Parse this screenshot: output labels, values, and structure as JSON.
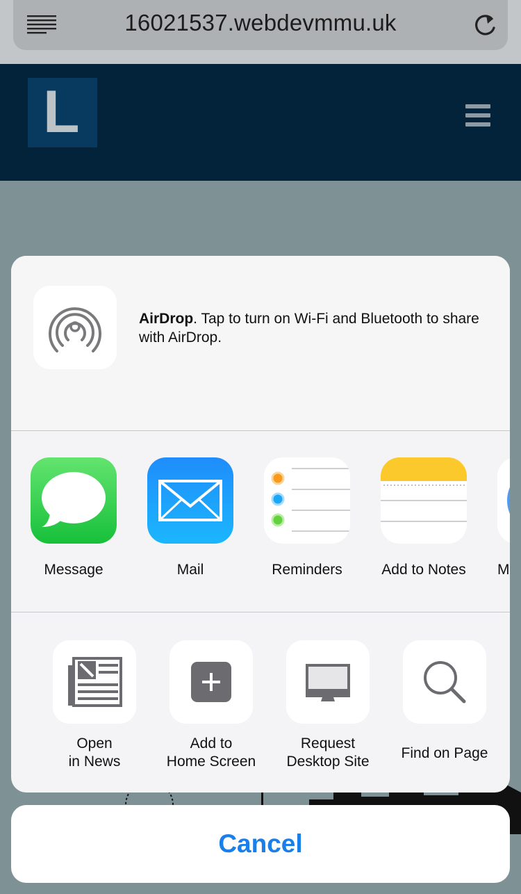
{
  "browser": {
    "url": "16021537.webdevmmu.uk",
    "reader_icon": "reader-view-icon",
    "reload_icon": "reload-icon"
  },
  "site": {
    "logo_letter": "L",
    "menu_icon": "hamburger-menu-icon",
    "colors": {
      "header": "#03233b",
      "logo_bg": "#073a5e"
    }
  },
  "share_sheet": {
    "airdrop": {
      "title": "AirDrop",
      "message": ". Tap to turn on Wi-Fi and Bluetooth to share with AirDrop.",
      "icon": "airdrop-icon"
    },
    "apps": [
      {
        "label": "Message",
        "icon": "messages-icon"
      },
      {
        "label": "Mail",
        "icon": "mail-icon"
      },
      {
        "label": "Reminders",
        "icon": "reminders-icon"
      },
      {
        "label": "Add to Notes",
        "icon": "notes-icon"
      },
      {
        "label": "M",
        "icon": "more-app-icon"
      }
    ],
    "actions": [
      {
        "label_line1": "Open",
        "label_line2": "in News",
        "icon": "news-icon"
      },
      {
        "label_line1": "Add to",
        "label_line2": "Home Screen",
        "icon": "add-icon"
      },
      {
        "label_line1": "Request",
        "label_line2": "Desktop Site",
        "icon": "desktop-icon"
      },
      {
        "label_line1": "Find on Page",
        "label_line2": "",
        "icon": "search-icon"
      }
    ],
    "cancel_label": "Cancel"
  },
  "colors": {
    "accent": "#1a80e8"
  }
}
